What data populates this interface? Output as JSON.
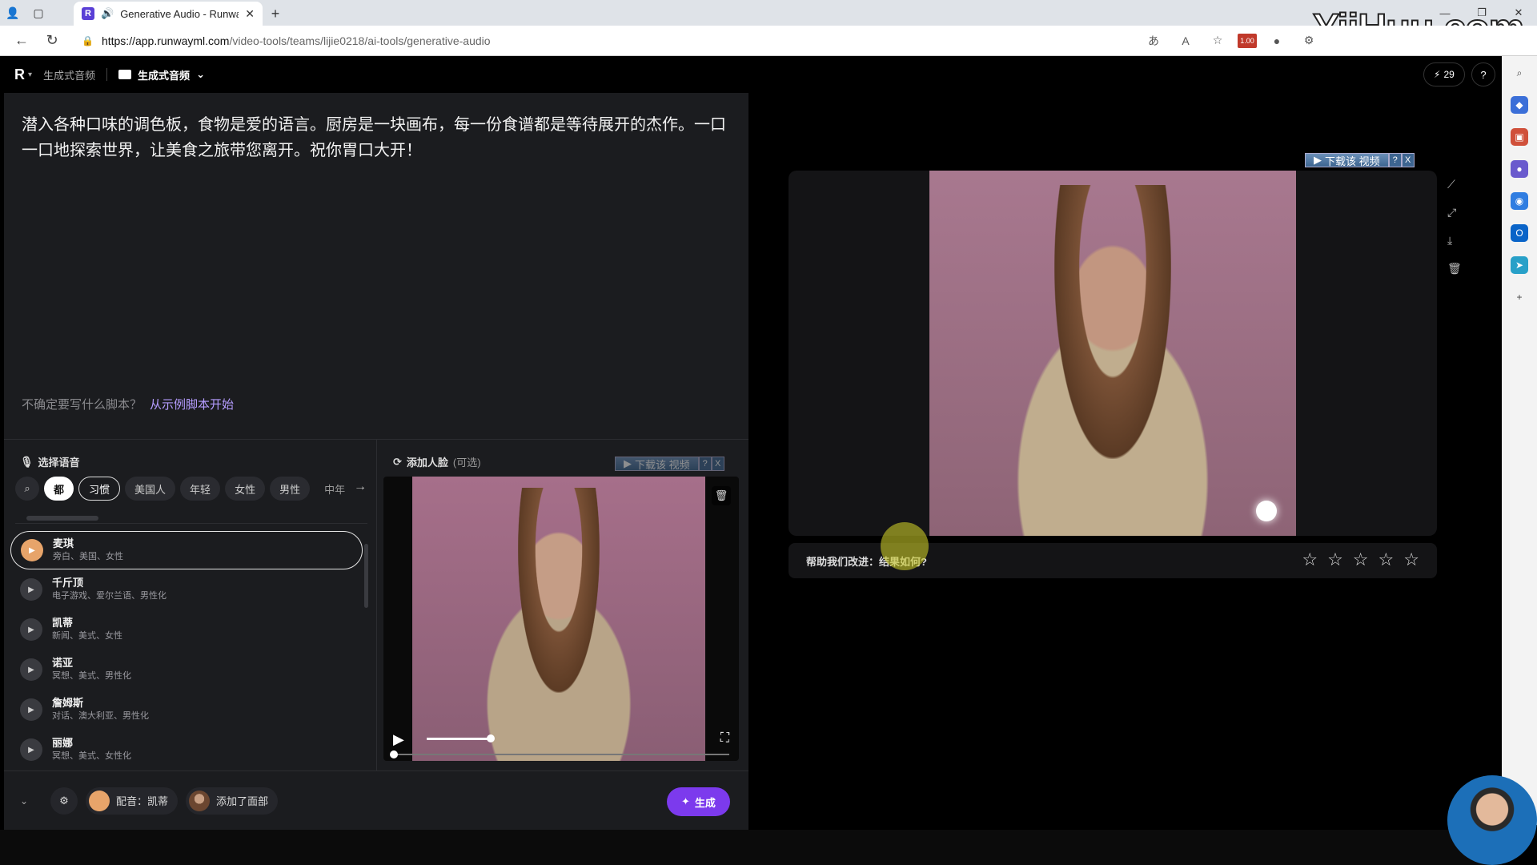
{
  "browser": {
    "tab_title": "Generative Audio - Runway",
    "url_host": "https://app.runwayml.com",
    "url_path": "/video-tools/teams/lijie0218/ai-tools/generative-audio",
    "extension_badge": "1.00"
  },
  "watermark": "YiiHuu.com",
  "header": {
    "breadcrumb": "生成式音频",
    "project": "生成式音频",
    "credits": "29",
    "help": "?"
  },
  "script": {
    "text": "潜入各种口味的调色板，食物是爱的语言。厨房是一块画布，每一份食谱都是等待展开的杰作。一口一口地探索世界，让美食之旅带您离开。祝你胃口大开！",
    "hint": "不确定要写什么脚本？",
    "hint_link": "从示例脚本开始"
  },
  "voice": {
    "title": "选择语音",
    "filters": [
      "都",
      "习惯",
      "美国人",
      "年轻",
      "女性",
      "男性",
      "中年"
    ],
    "items": [
      {
        "name": "麦琪",
        "desc": "旁白、美国、女性"
      },
      {
        "name": "千斤顶",
        "desc": "电子游戏、爱尔兰语、男性化"
      },
      {
        "name": "凯蒂",
        "desc": "新闻、美式、女性"
      },
      {
        "name": "诺亚",
        "desc": "冥想、美式、男性化"
      },
      {
        "name": "詹姆斯",
        "desc": "对话、澳大利亚、男性化"
      },
      {
        "name": "丽娜",
        "desc": "冥想、美式、女性化"
      }
    ]
  },
  "face": {
    "title": "添加人脸",
    "optional": "(可选)"
  },
  "download_overlay": {
    "label": "下载该 视频",
    "q": "?",
    "x": "X"
  },
  "bottom": {
    "voice_label": "配音：凯蒂",
    "face_label": "添加了面部",
    "generate": "生成"
  },
  "result": {
    "rating_prompt": "帮助我们改进：结果如何?",
    "stars": [
      "☆",
      "☆",
      "☆",
      "☆",
      "☆"
    ]
  }
}
